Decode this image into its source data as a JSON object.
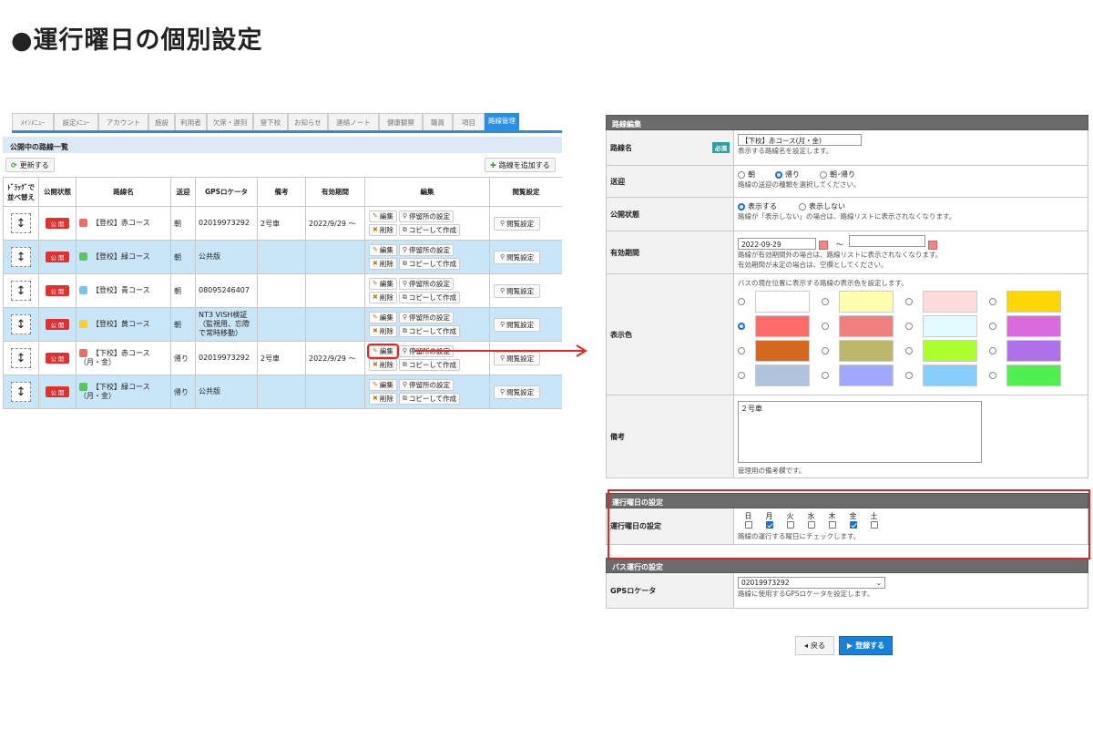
{
  "title": "●運行曜日の個別設定",
  "nav_tabs": [
    "ﾒｲﾝﾒﾆｭｰ",
    "設定ﾒﾆｭｰ",
    "アカウント",
    "施設",
    "利用者",
    "欠席・遅刻",
    "登下校",
    "お知らせ",
    "連絡ノート",
    "健康観察",
    "職員",
    "項目",
    "路線管理"
  ],
  "route_list": {
    "heading": "公開中の路線一覧",
    "refresh": "更新する",
    "add_route": "路線を追加する",
    "columns": [
      "ﾄﾞﾗｯｸﾞで並べ替え",
      "公開状態",
      "路線名",
      "送迎",
      "GPSロケータ",
      "備考",
      "有効期間",
      "編集",
      "閲覧設定"
    ],
    "status_label": "公 開",
    "edit": "編集",
    "stop": "停留所の設定",
    "delete": "削除",
    "copy": "コピーして作成",
    "view": "閲覧設定",
    "rows": [
      {
        "name": "【登校】赤コース",
        "color": "#f06a6a",
        "dir": "朝",
        "gps": "02019973292",
        "note": "2号車",
        "period": "2022/9/29 ～"
      },
      {
        "name": "【登校】緑コース",
        "color": "#55c858",
        "dir": "朝",
        "gps": "公共版",
        "note": "",
        "period": ""
      },
      {
        "name": "【登校】青コース",
        "color": "#7ec3ef",
        "dir": "朝",
        "gps": "08095246407",
        "note": "",
        "period": ""
      },
      {
        "name": "【登校】黄コース",
        "color": "#ffd21a",
        "dir": "朝",
        "gps": "NT3 VISH検証（監視用、忘際で常時移動）",
        "note": "",
        "period": ""
      },
      {
        "name": "【下校】赤コース（月・金）",
        "color": "#f06a6a",
        "dir": "帰り",
        "gps": "02019973292",
        "note": "2号車",
        "period": "2022/9/29 ～"
      },
      {
        "name": "【下校】緑コース（月・金）",
        "color": "#55c858",
        "dir": "帰り",
        "gps": "公共版",
        "note": "",
        "period": ""
      }
    ]
  },
  "edit_form": {
    "section": "路線編集",
    "name_label": "路線名",
    "required": "必須",
    "name_value": "【下校】赤コース(月・金)",
    "name_help": "表示する路線名を設定します。",
    "dir_label": "送迎",
    "dir_options": [
      "朝",
      "帰り",
      "朝･帰り"
    ],
    "dir_selected": 1,
    "dir_help": "路線の送迎の種類を選択してください。",
    "pub_label": "公開状態",
    "pub_options": [
      "表示する",
      "表示しない"
    ],
    "pub_selected": 0,
    "pub_help": "路線が「表示しない」の場合は、路線リストに表示されなくなります。",
    "period_label": "有効期間",
    "period_start": "2022-09-29",
    "period_sep": "～",
    "period_end": "",
    "period_help1": "路線が有効期間外の場合は、路線リストに表示されなくなります。",
    "period_help2": "有効期間が未定の場合は、空欄としてください。",
    "color_label": "表示色",
    "color_help": "バスの現在位置に表示する路線の表示色を設定します。",
    "colors": [
      "#ffffff",
      "#ffffb0",
      "#ffdcdc",
      "#ffd700",
      "#ff6b6b",
      "#f08080",
      "#e0faff",
      "#da6ade",
      "#d2691e",
      "#bdb76b",
      "#adff2f",
      "#b070e8",
      "#b0c4de",
      "#a0a8ff",
      "#87cefa",
      "#50f050"
    ],
    "color_selected": 4,
    "memo_label": "備考",
    "memo_value": "２号車",
    "memo_help": "管理用の備考欄です。"
  },
  "weekday": {
    "section": "運行曜日の設定",
    "label": "運行曜日の設定",
    "days": [
      "日",
      "月",
      "火",
      "水",
      "木",
      "金",
      "土"
    ],
    "checked": [
      false,
      true,
      false,
      false,
      false,
      true,
      false
    ],
    "help": "路線の運行する曜日にチェックします。"
  },
  "bus": {
    "section": "バス運行の設定",
    "gps_label": "GPSロケータ",
    "gps_value": "02019973292",
    "gps_help": "路線に使用するGPSロケータを設定します。"
  },
  "buttons": {
    "back": "戻る",
    "save": "登録する"
  }
}
